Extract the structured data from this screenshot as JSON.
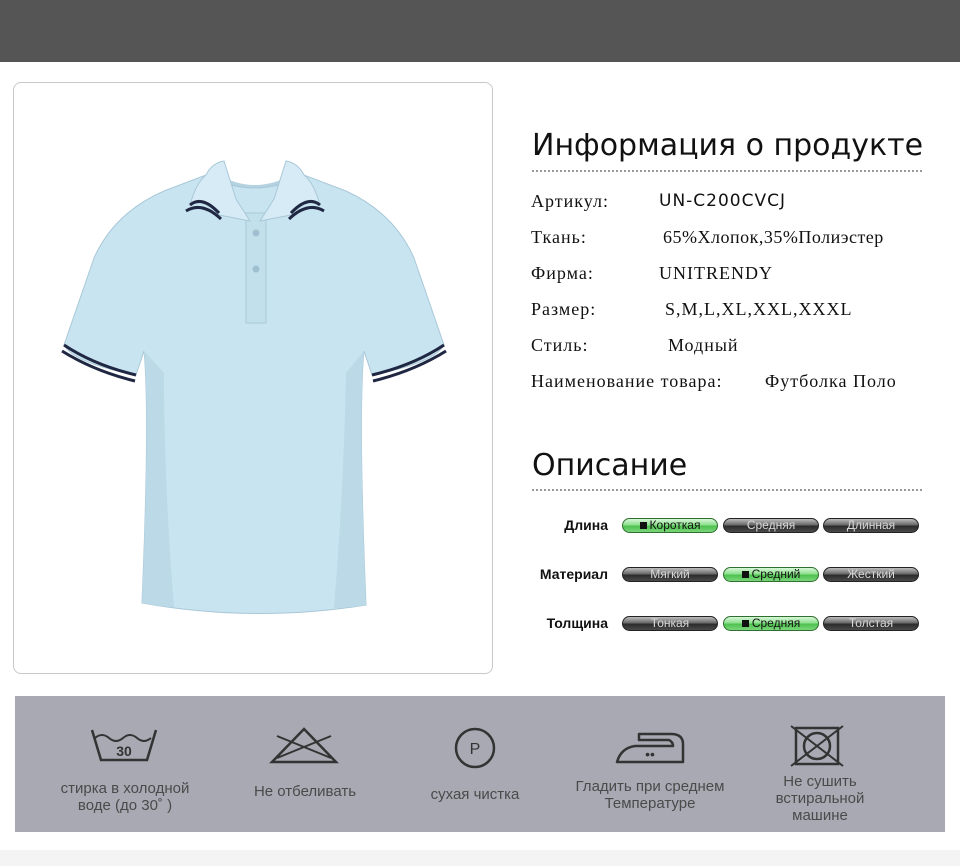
{
  "product_info": {
    "title": "Информация о продукте",
    "rows": [
      {
        "label": "Артикул:",
        "value": "UN-C200CVCJ"
      },
      {
        "label": "Ткань:",
        "value": "65%Хлопок,35%Полиэстер"
      },
      {
        "label": "Фирма:",
        "value": "UNITRENDY"
      },
      {
        "label": "Размер:",
        "value": "S,M,L,XL,XXL,XXXL"
      },
      {
        "label": "Стиль:",
        "value": "Модный"
      },
      {
        "label": "Наименование товара:",
        "value": "Футболка Поло"
      }
    ]
  },
  "description": {
    "title": "Описание",
    "attributes": [
      {
        "label": "Длина",
        "options": [
          "Короткая",
          "Средняя",
          "Длинная"
        ],
        "selected": 0
      },
      {
        "label": "Материал",
        "options": [
          "Мягкий",
          "Средний",
          "Жесткий"
        ],
        "selected": 1
      },
      {
        "label": "Толщина",
        "options": [
          "Тонкая",
          "Средняя",
          "Толстая"
        ],
        "selected": 1
      }
    ]
  },
  "care": {
    "wash_number": "30",
    "iron_dots": "••",
    "dry_clean_letter": "P",
    "items": [
      {
        "icon": "wash-30-icon",
        "text": "стирка в холодной воде (до 30˚ )"
      },
      {
        "icon": "no-bleach-icon",
        "text": "Не отбеливать"
      },
      {
        "icon": "dry-clean-p-icon",
        "text": "сухая чистка"
      },
      {
        "icon": "iron-medium-icon",
        "text": "Гладить при среднем Температуре"
      },
      {
        "icon": "no-tumble-dry-icon",
        "text": "Не сушить встиральной машине"
      }
    ]
  },
  "colors": {
    "shirt": "#c9e4f1",
    "stripe_dark": "#1f2742",
    "pill_selected": "#5fcf5f",
    "care_bg": "#a9a9b4",
    "top_bar": "#555555"
  }
}
